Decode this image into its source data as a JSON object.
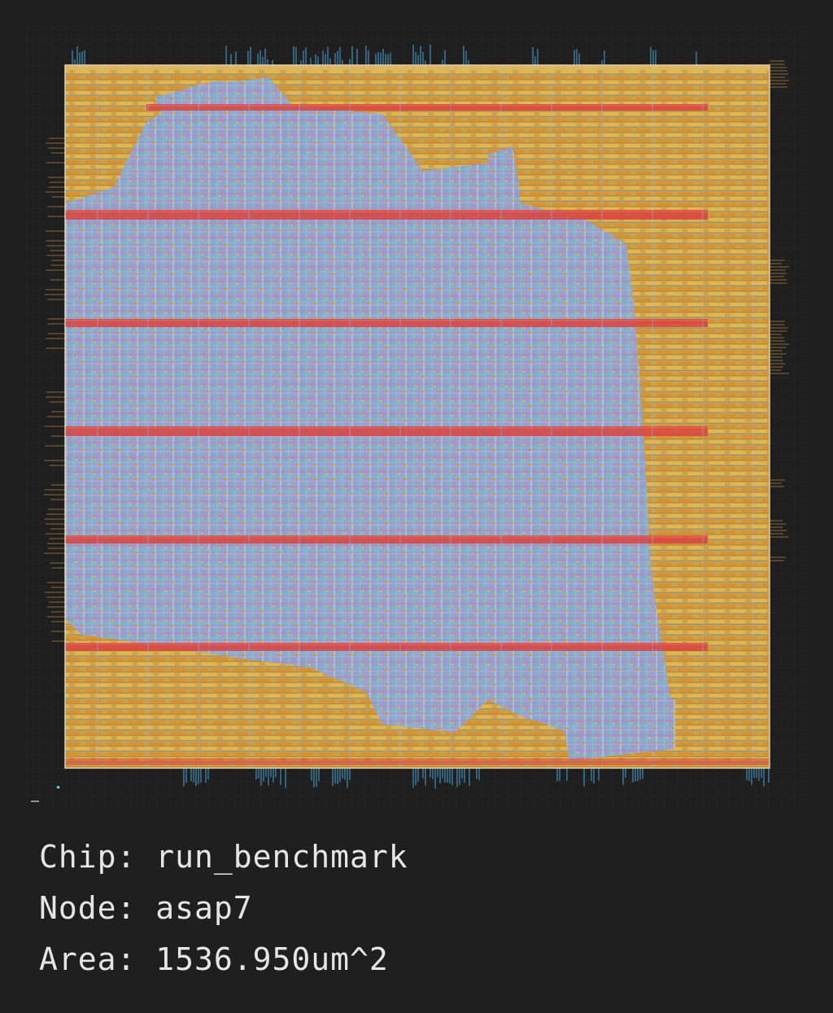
{
  "info": {
    "chip_line": "Chip: run_benchmark",
    "node_line": "Node: asap7",
    "area_line": "Area: 1536.950um^2"
  },
  "colors": {
    "background": "#1f1f1f",
    "die_grid": "#2a2a2a",
    "core_fill": "#c9a24a",
    "row_cell_orange": "#d9922f",
    "row_cell_gold": "#e2b64e",
    "power_stripe": "#d9433f",
    "routing_blue": "#7aa0d8",
    "routing_cyan": "#69d6d0",
    "routing_violet": "#b08ad8",
    "routing_pink": "#d86fa0",
    "pin_blue": "#4aa3d8",
    "io_trace": "#8a6a3a",
    "text": "#e6e6e6"
  }
}
